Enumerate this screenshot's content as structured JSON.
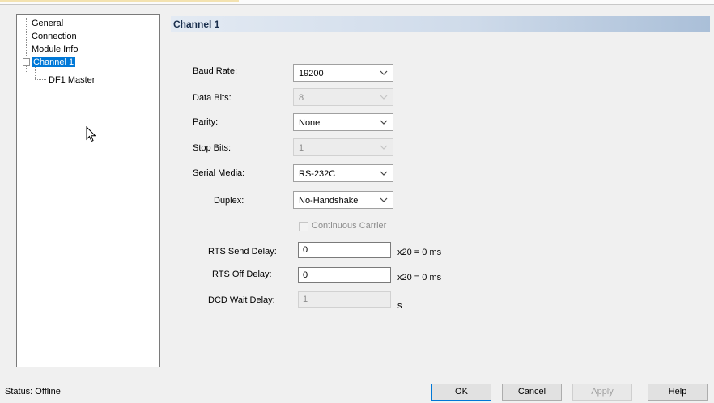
{
  "tree": {
    "items": [
      {
        "label": "General"
      },
      {
        "label": "Connection"
      },
      {
        "label": "Module Info"
      },
      {
        "label": "Channel 1"
      },
      {
        "label": "DF1 Master"
      }
    ]
  },
  "panel": {
    "title": "Channel 1",
    "baud_rate": {
      "label": "Baud Rate:",
      "value": "19200"
    },
    "data_bits": {
      "label": "Data Bits:",
      "value": "8"
    },
    "parity": {
      "label": "Parity:",
      "value": "None"
    },
    "stop_bits": {
      "label": "Stop Bits:",
      "value": "1"
    },
    "serial_media": {
      "label": "Serial Media:",
      "value": "RS-232C"
    },
    "duplex": {
      "label": "Duplex:",
      "value": "No-Handshake"
    },
    "continuous_carrier": {
      "label": "Continuous Carrier",
      "checked": false
    },
    "rts_send_delay": {
      "label": "RTS Send Delay:",
      "value": "0",
      "unit": "x20 = 0 ms"
    },
    "rts_off_delay": {
      "label": "RTS Off Delay:",
      "value": "0",
      "unit": "x20 = 0 ms"
    },
    "dcd_wait_delay": {
      "label": "DCD Wait Delay:",
      "value": "1",
      "unit": "s"
    }
  },
  "footer": {
    "status": "Status:  Offline",
    "ok": "OK",
    "cancel": "Cancel",
    "apply": "Apply",
    "help": "Help"
  },
  "colors": {
    "selection": "#0078d7",
    "header_start": "#e3eaf3",
    "header_end": "#aabfd8"
  },
  "icons": [
    "tree-expander-minus-icon",
    "mouse-pointer-icon",
    "dropdown-arrow-icon"
  ]
}
